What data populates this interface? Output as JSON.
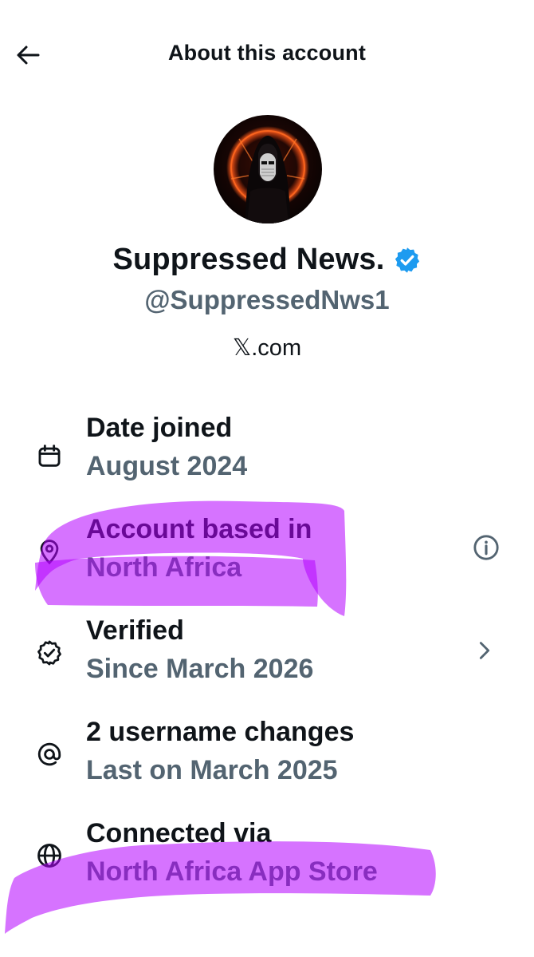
{
  "header": {
    "title": "About this account",
    "back_icon": "arrow-left-icon"
  },
  "profile": {
    "display_name": "Suppressed News.",
    "handle": "@SuppressedNws1",
    "link": "𝕏.com",
    "verified_color": "#1d9bf0"
  },
  "details": [
    {
      "icon": "calendar-icon",
      "label": "Date joined",
      "value": "August 2024"
    },
    {
      "icon": "location-pin-icon",
      "label": "Account based in",
      "value": "North Africa",
      "action": "info-icon"
    },
    {
      "icon": "verified-badge-outline-icon",
      "label": "Verified",
      "value": "Since March 2026",
      "action": "chevron-right-icon"
    },
    {
      "icon": "at-sign-icon",
      "label": "2 username changes",
      "value": "Last on March 2025"
    },
    {
      "icon": "globe-icon",
      "label": "Connected via",
      "value": "North Africa App Store"
    }
  ],
  "annotation": {
    "highlighter_color": "#b400ff"
  },
  "colors": {
    "text": "#0f1419",
    "secondary": "#536471"
  }
}
